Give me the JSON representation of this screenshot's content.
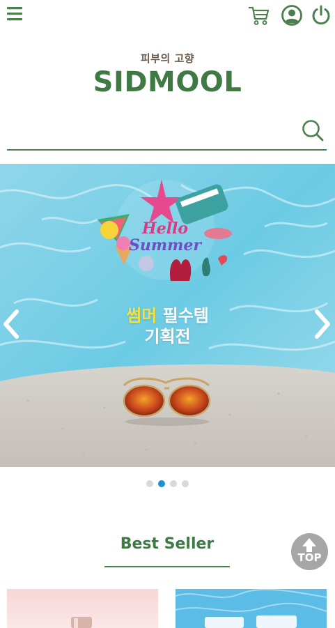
{
  "header": {
    "icons": [
      "menu-icon",
      "cart-icon",
      "user-icon",
      "power-icon"
    ],
    "accent_color": "#3f7a45"
  },
  "brand": {
    "tagline": "피부의 고향",
    "logo": "SIDMOOL"
  },
  "search": {
    "value": "",
    "placeholder": ""
  },
  "banner": {
    "line1_highlight": "썸머",
    "line1_rest": " 필수템",
    "line2": "기획전",
    "artwork_text": "Hello Summer",
    "slide_count": 4,
    "active_slide": 2
  },
  "section": {
    "title": "Best Seller"
  },
  "top_button": {
    "label": "TOP"
  },
  "colors": {
    "brand_green": "#3f7a45",
    "active_dot": "#1e90d8",
    "inactive_dot": "#d9d9d9",
    "highlight_yellow": "#f5e13a"
  }
}
